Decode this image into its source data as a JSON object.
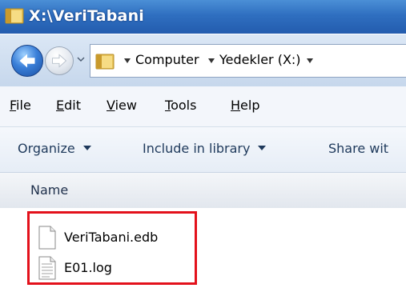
{
  "window": {
    "title": "X:\\VeriTabani"
  },
  "address": {
    "crumbs": [
      "Computer",
      "Yedekler (X:)"
    ]
  },
  "menu": {
    "items": [
      {
        "key": "F",
        "rest": "ile"
      },
      {
        "key": "E",
        "rest": "dit"
      },
      {
        "key": "V",
        "rest": "iew"
      },
      {
        "key": "T",
        "rest": "ools"
      },
      {
        "key": "H",
        "rest": "elp"
      }
    ]
  },
  "commands": {
    "organize": "Organize",
    "include": "Include in library",
    "share": "Share wit"
  },
  "columns": {
    "name": "Name"
  },
  "files": [
    {
      "name": "VeriTabani.edb",
      "icon": "document-icon"
    },
    {
      "name": "E01.log",
      "icon": "text-file-icon"
    }
  ],
  "colors": {
    "highlight": "#e3111b",
    "titlebar": "#2f6fc0"
  }
}
